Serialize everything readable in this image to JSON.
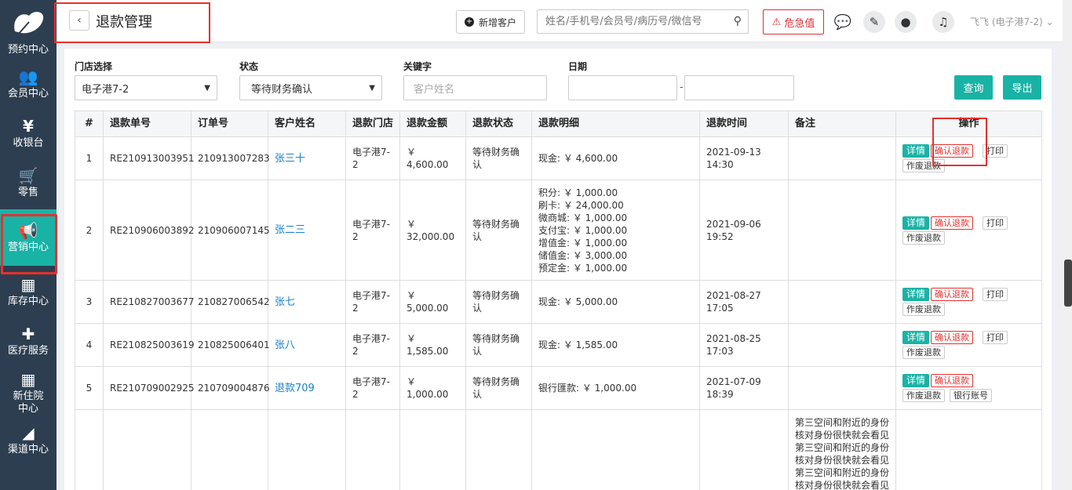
{
  "sidebar": {
    "items": [
      {
        "label": "预约中心",
        "icon": "calendar-icon"
      },
      {
        "label": "会员中心",
        "icon": "users-icon"
      },
      {
        "label": "收银台",
        "icon": "yen-icon"
      },
      {
        "label": "零售",
        "icon": "cart-icon"
      },
      {
        "label": "营销中心",
        "icon": "megaphone-icon"
      },
      {
        "label": "库存中心",
        "icon": "grid-icon"
      },
      {
        "label": "医疗服务",
        "icon": "medkit-icon"
      },
      {
        "label": "新住院中心",
        "icon": "hospital-icon"
      },
      {
        "label": "渠道中心",
        "icon": "sitemap-icon"
      }
    ]
  },
  "header": {
    "back_icon": "‹",
    "title": "退款管理",
    "new_customer": "新增客户",
    "search_placeholder": "姓名/手机号/会员号/病历号/微信号",
    "danger_label": "危急值",
    "user": "飞飞 (电子港7-2)"
  },
  "filters": {
    "store_label": "门店选择",
    "store_value": "电子港7-2",
    "status_label": "状态",
    "status_value": "等待财务确认",
    "keyword_label": "关键字",
    "keyword_placeholder": "客户姓名",
    "date_label": "日期",
    "date_sep": "-",
    "query_btn": "查询",
    "export_btn": "导出"
  },
  "table": {
    "columns": [
      "#",
      "退款单号",
      "订单号",
      "客户姓名",
      "退款门店",
      "退款金额",
      "退款状态",
      "退款明细",
      "退款时间",
      "备注",
      "操作"
    ],
    "rows": [
      {
        "idx": "1",
        "refund_no": "RE210913003951",
        "order_no": "210913007283",
        "customer": "张三十",
        "store": "电子港7-2",
        "amount": "￥ 4,600.00",
        "status": "等待财务确认",
        "detail": [
          "现金: ￥ 4,600.00"
        ],
        "time": "2021-09-13 14:30",
        "note": "",
        "ops": [
          "详情",
          "确认退款",
          "打印",
          "作废退款"
        ]
      },
      {
        "idx": "2",
        "refund_no": "RE210906003892",
        "order_no": "210906007145",
        "customer": "张二三",
        "store": "电子港7-2",
        "amount": "￥ 32,000.00",
        "status": "等待财务确认",
        "detail": [
          "积分: ￥ 1,000.00",
          "刷卡: ￥ 24,000.00",
          "微商城: ￥ 1,000.00",
          "支付宝: ￥ 1,000.00",
          "增值金: ￥ 1,000.00",
          "储值金: ￥ 3,000.00",
          "预定金: ￥ 1,000.00"
        ],
        "time": "2021-09-06 19:52",
        "note": "",
        "ops": [
          "详情",
          "确认退款",
          "打印",
          "作废退款"
        ]
      },
      {
        "idx": "3",
        "refund_no": "RE210827003677",
        "order_no": "210827006542",
        "customer": "张七",
        "store": "电子港7-2",
        "amount": "￥ 5,000.00",
        "status": "等待财务确认",
        "detail": [
          "现金: ￥ 5,000.00"
        ],
        "time": "2021-08-27 17:05",
        "note": "",
        "ops": [
          "详情",
          "确认退款",
          "打印",
          "作废退款"
        ]
      },
      {
        "idx": "4",
        "refund_no": "RE210825003619",
        "order_no": "210825006401",
        "customer": "张八",
        "store": "电子港7-2",
        "amount": "￥ 1,585.00",
        "status": "等待财务确认",
        "detail": [
          "现金: ￥ 1,585.00"
        ],
        "time": "2021-08-25 17:03",
        "note": "",
        "ops": [
          "详情",
          "确认退款",
          "打印",
          "作废退款"
        ]
      },
      {
        "idx": "5",
        "refund_no": "RE210709002925",
        "order_no": "210709004876",
        "customer": "退款709",
        "store": "电子港7-2",
        "amount": "￥ 1,000.00",
        "status": "等待财务确认",
        "detail": [
          "银行匯款: ￥ 1,000.00"
        ],
        "time": "2021-07-09 18:39",
        "note": "",
        "ops": [
          "详情",
          "确认退款",
          "作废退款",
          "银行账号"
        ]
      },
      {
        "idx": "",
        "refund_no": "",
        "order_no": "",
        "customer": "",
        "store": "",
        "amount": "",
        "status": "",
        "detail": [],
        "time": "",
        "note": "第三空间和附近的身份核对身份很快就会看见第三空间和附近的身份核对身份很快就会看见第三空间和附近的身份核对身份很快就会看见",
        "ops": []
      }
    ]
  }
}
